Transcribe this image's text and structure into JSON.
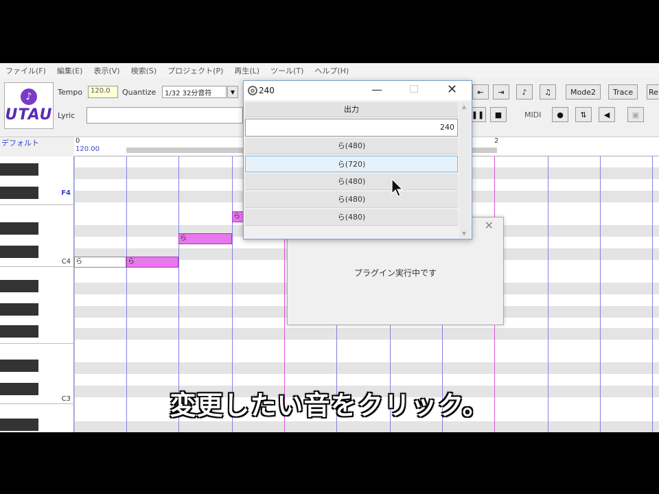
{
  "menu": [
    "ファイル(F)",
    "編集(E)",
    "表示(V)",
    "検索(S)",
    "プロジェクト(P)",
    "再生(L)",
    "ツール(T)",
    "ヘルプ(H)"
  ],
  "toolbar": {
    "logo_text": "UTAU",
    "tempo_label": "Tempo",
    "tempo_value": "120.0",
    "quantize_label": "Quantize",
    "quantize_value": "1/32 32分音符",
    "lyric_label": "Lyric",
    "mode2_label": "Mode2",
    "trace_label": "Trace",
    "re_label": "Re",
    "midi_label": "MIDI"
  },
  "track": {
    "name": "デフォルト"
  },
  "ruler": {
    "tempo": "120.00",
    "bar_start": "0",
    "bar_two": "2"
  },
  "keys": {
    "f4": "F4",
    "c4": "C4",
    "c3": "C3"
  },
  "notes": [
    {
      "lyric": "ら"
    },
    {
      "lyric": "ら"
    },
    {
      "lyric": "ら"
    },
    {
      "lyric": "ら"
    }
  ],
  "plugin_window": {
    "message": "プラグイン実行中です"
  },
  "dialog": {
    "title": "240",
    "column_header": "出力",
    "value": "240",
    "items": [
      "ら(480)",
      "ら(720)",
      "ら(480)",
      "ら(480)",
      "ら(480)"
    ],
    "selected_index": 1
  },
  "subtitle": "変更したい音をクリック。",
  "colors": {
    "note_fill": "#e878ee",
    "logo": "#5a2ab5",
    "selection": "#e6f2fb"
  }
}
